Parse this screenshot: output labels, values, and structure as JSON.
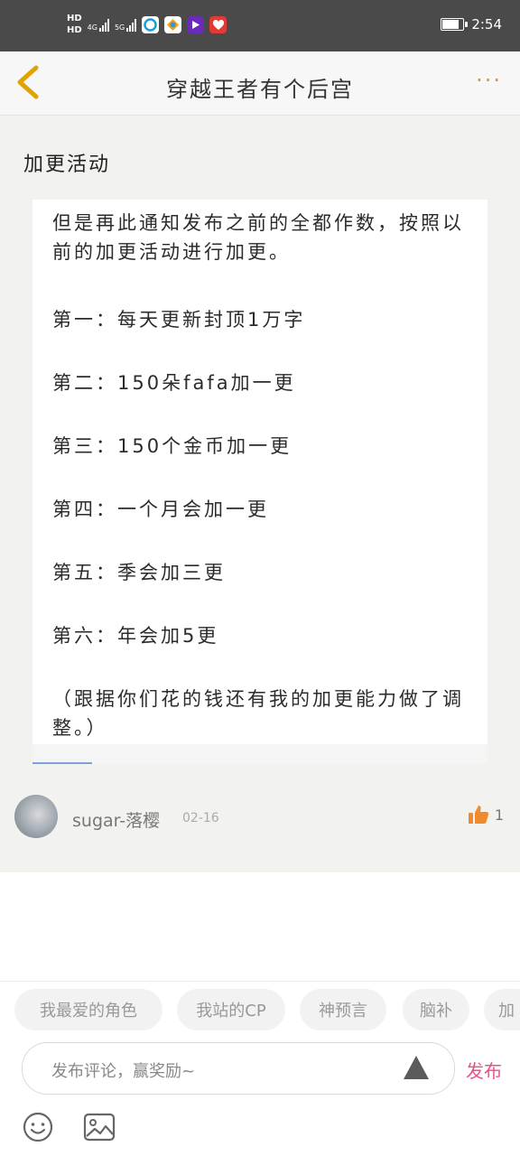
{
  "status_bar": {
    "hd1": "HD",
    "hd2": "HD",
    "net1": "4G",
    "net2": "5G",
    "battery_level": 0.8,
    "time": "2:54"
  },
  "nav": {
    "title": "穿越王者有个后宫",
    "more": "···"
  },
  "post": {
    "title": "加更活动",
    "paragraphs": [
      "但是再此通知发布之前的全都作数，按照以前的加更活动进行加更。",
      "第一：每天更新封顶1万字",
      "第二：150朵fafa加一更",
      "第三：150个金币加一更",
      "第四：一个月会加一更",
      "第五：季会加三更",
      "第六：年会加5更",
      "（跟据你们花的钱还有我的加更能力做了调整。）"
    ]
  },
  "comment": {
    "username": "sugar-落樱",
    "date": "02-16",
    "likes": "1"
  },
  "tags": [
    "我最爱的角色",
    "我站的CP",
    "神预言",
    "脑补",
    "加"
  ],
  "input": {
    "placeholder": "发布评论，赢奖励~",
    "publish": "发布"
  },
  "colors": {
    "accent_orange": "#f08a2e",
    "publish_pink": "#e8508c",
    "back_arrow": "#e0a300"
  }
}
